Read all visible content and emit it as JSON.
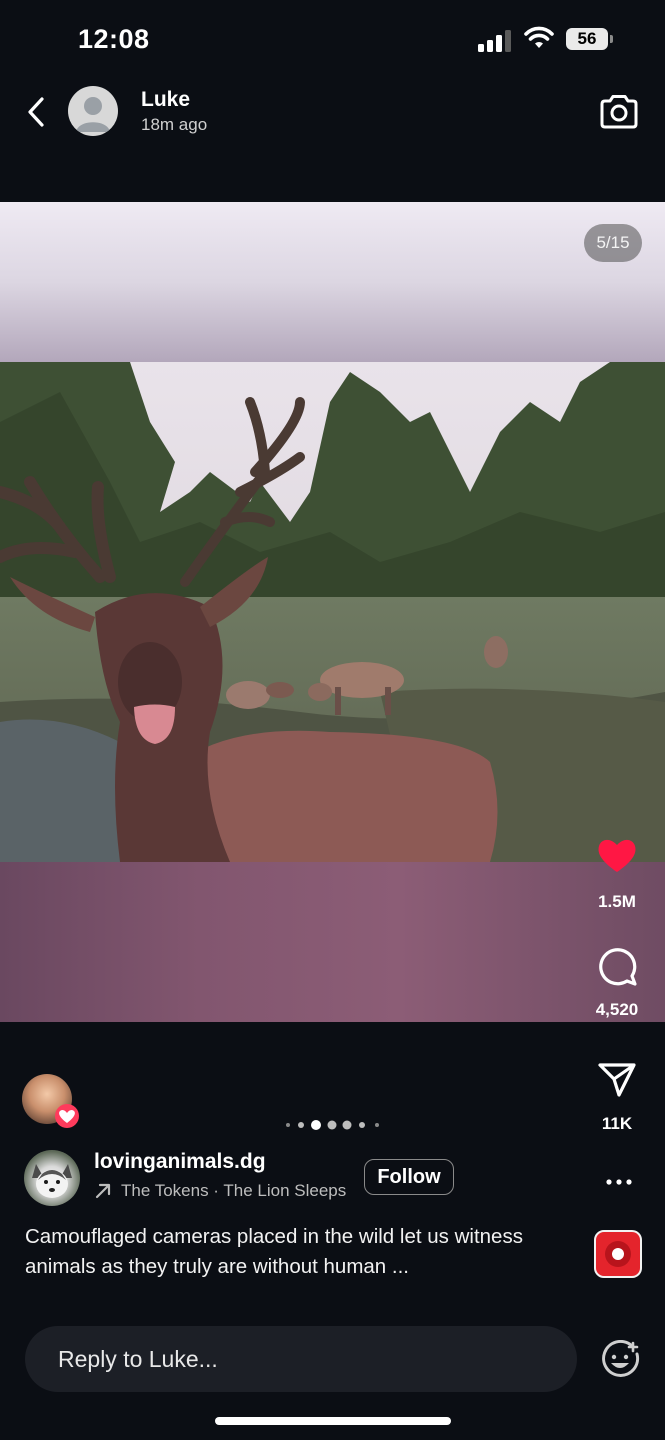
{
  "status_bar": {
    "time": "12:08",
    "battery": "56",
    "signal_icon": "cellular-signal-icon",
    "wifi_icon": "wifi-icon",
    "battery_icon": "battery-icon"
  },
  "header": {
    "user_name": "Luke",
    "time_ago": "18m ago",
    "back_icon": "chevron-left-icon",
    "camera_icon": "camera-icon"
  },
  "media": {
    "counter": "5/15"
  },
  "actions": {
    "likes": "1.5M",
    "comments": "4,520",
    "shares": "11K",
    "liked": true,
    "heart_color": "#ff1744"
  },
  "carousel": {
    "dot_count": 7,
    "active_index": 2
  },
  "post": {
    "author": "lovinganimals.dg",
    "music": "The Tokens · The Lion Sleeps",
    "follow_label": "Follow",
    "caption": "Camouflaged cameras placed in the wild let us witness animals as they truly are without human ..."
  },
  "reply": {
    "placeholder": "Reply to Luke..."
  }
}
